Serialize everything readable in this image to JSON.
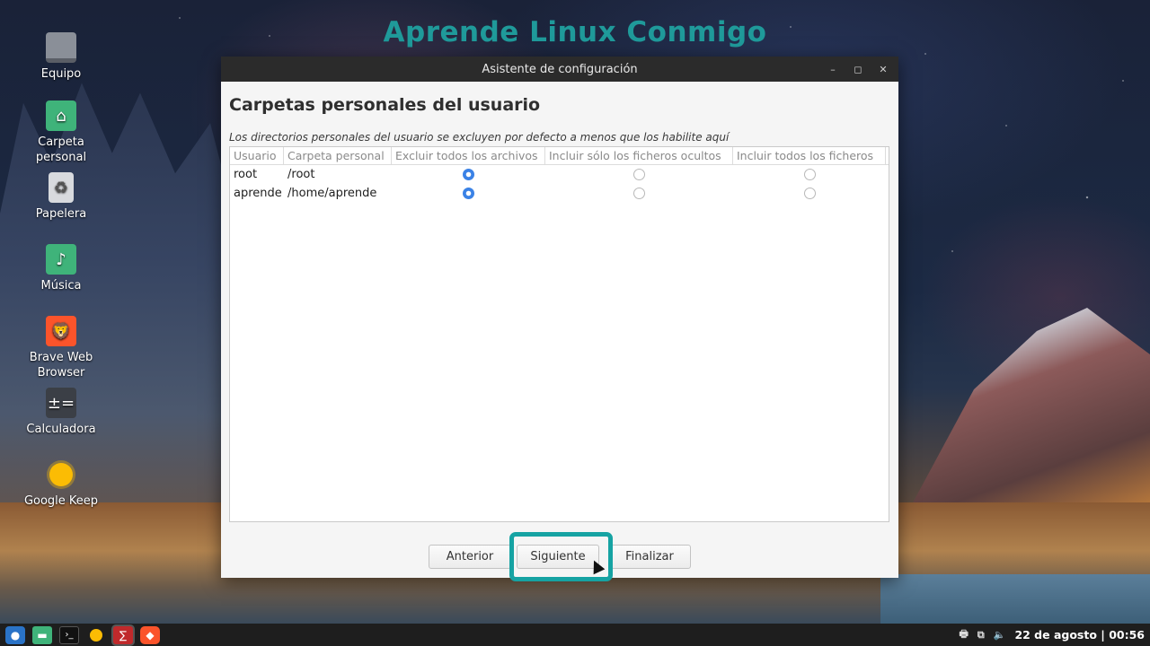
{
  "banner": "Aprende Linux Conmigo",
  "desktop": {
    "icons": [
      {
        "label": "Equipo",
        "icon": "monitor-icon"
      },
      {
        "label": "Carpeta personal",
        "icon": "home-folder-icon"
      },
      {
        "label": "Papelera",
        "icon": "trash-icon"
      },
      {
        "label": "Música",
        "icon": "music-folder-icon"
      },
      {
        "label": "Brave Web Browser",
        "icon": "brave-icon"
      },
      {
        "label": "Calculadora",
        "icon": "calculator-icon"
      },
      {
        "label": "Google Keep",
        "icon": "keep-icon"
      }
    ]
  },
  "window": {
    "title": "Asistente de configuración",
    "page_title": "Carpetas personales del usuario",
    "description": "Los directorios personales del usuario se excluyen por defecto a menos que los habilite aquí",
    "columns": [
      "Usuario",
      "Carpeta personal",
      "Excluir todos los archivos",
      "Incluir sólo los ficheros ocultos",
      "Incluir todos los ficheros"
    ],
    "rows": [
      {
        "user": "root",
        "folder": "/root",
        "selected": "exclude_all"
      },
      {
        "user": "aprende",
        "folder": "/home/aprende",
        "selected": "exclude_all"
      }
    ],
    "buttons": {
      "prev": "Anterior",
      "next": "Siguiente",
      "finish": "Finalizar"
    }
  },
  "taskbar": {
    "clock": "22 de agosto | 00:56"
  },
  "colors": {
    "banner": "#1f9a9a",
    "highlight": "#16a3a3",
    "radio_selected": "#3b82e6"
  }
}
